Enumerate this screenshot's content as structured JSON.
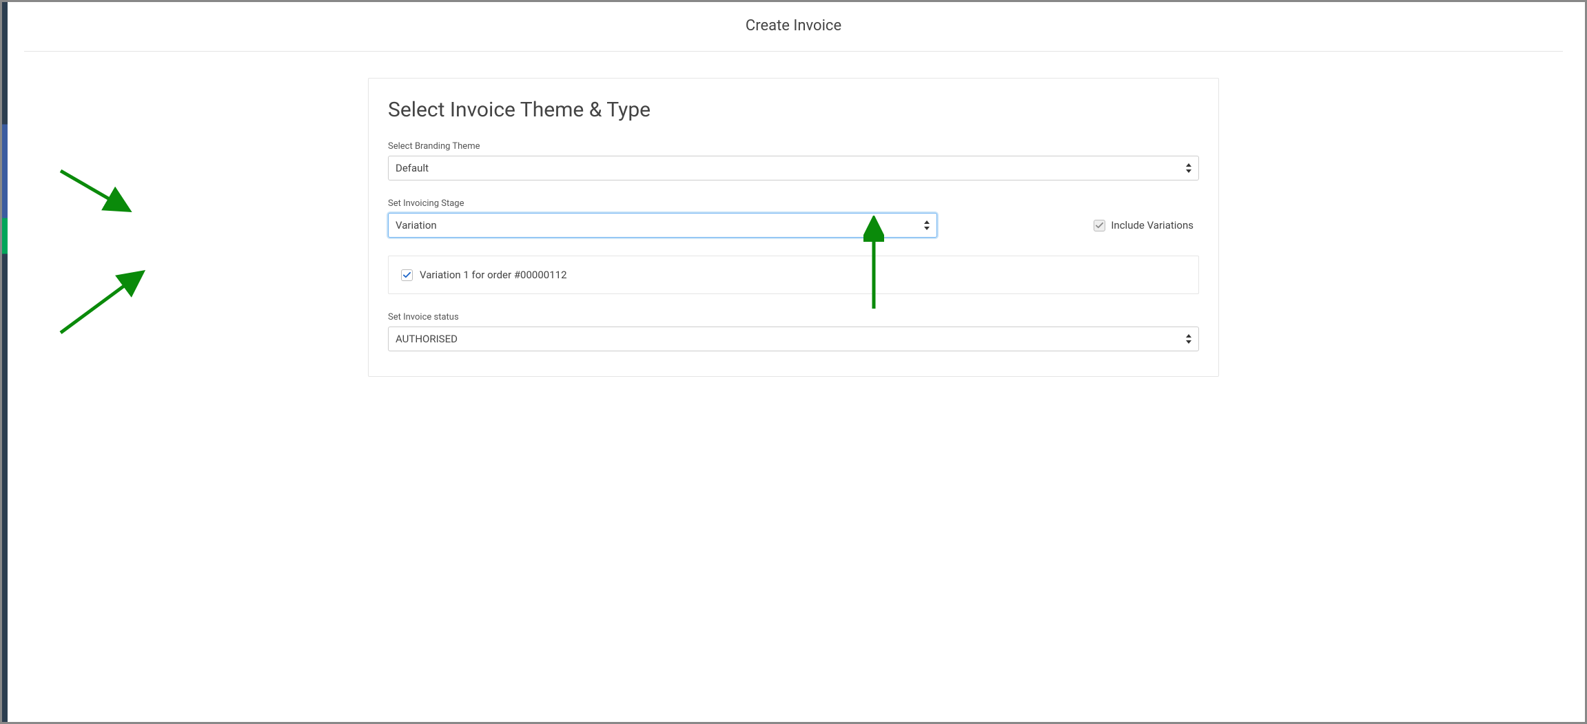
{
  "header": {
    "title": "Create Invoice"
  },
  "card": {
    "title": "Select Invoice Theme & Type"
  },
  "branding": {
    "label": "Select Branding Theme",
    "value": "Default"
  },
  "stage": {
    "label": "Set Invoicing Stage",
    "value": "Variation"
  },
  "include_variations": {
    "label": "Include Variations",
    "checked": true
  },
  "variations": [
    {
      "label": "Variation 1 for order #00000112",
      "checked": true
    }
  ],
  "status": {
    "label": "Set Invoice status",
    "value": "AUTHORISED"
  }
}
